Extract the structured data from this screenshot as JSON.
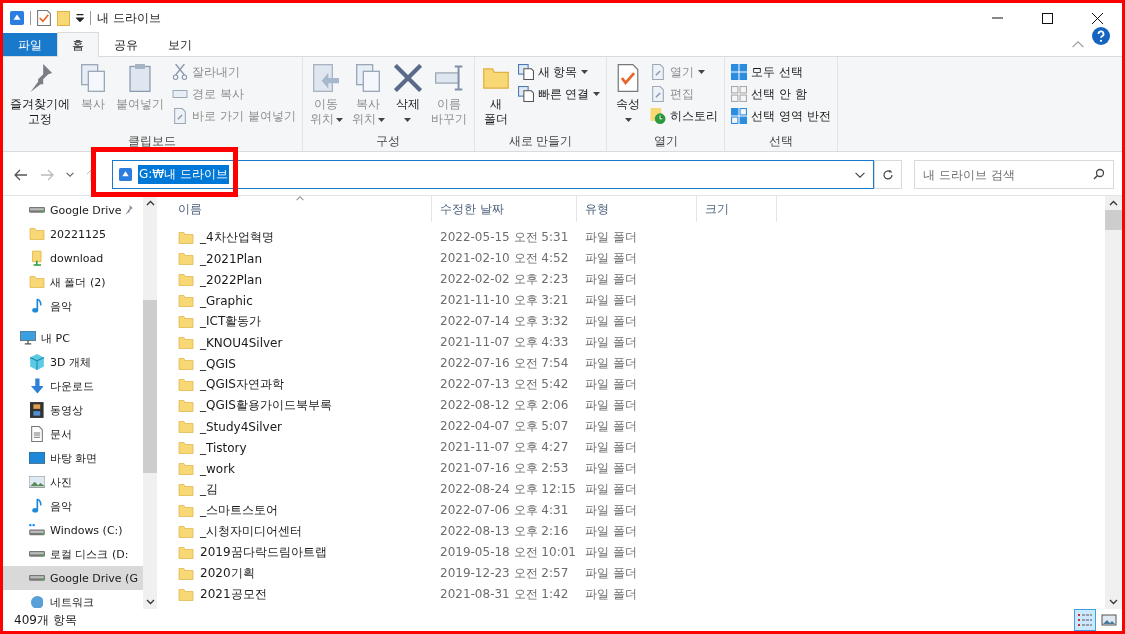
{
  "window": {
    "title": "내 드라이브"
  },
  "ribbon_tabs": [
    {
      "label": "파일",
      "kind": "file",
      "selected": false
    },
    {
      "label": "홈",
      "kind": "tab",
      "selected": true
    },
    {
      "label": "공유",
      "kind": "tab",
      "selected": false
    },
    {
      "label": "보기",
      "kind": "tab",
      "selected": false
    }
  ],
  "ribbon_groups": [
    {
      "label": "클립보드",
      "large": [
        {
          "label": "즐겨찾기에\n고정",
          "kind": "pin",
          "disabled": false
        },
        {
          "label": "복사",
          "kind": "copy",
          "disabled": true
        },
        {
          "label": "붙여넣기",
          "kind": "paste",
          "disabled": true
        }
      ],
      "small": [
        {
          "label": "잘라내기",
          "kind": "cut",
          "disabled": true
        },
        {
          "label": "경로 복사",
          "kind": "path",
          "disabled": true
        },
        {
          "label": "바로 가기 붙여넣기",
          "kind": "shortcut",
          "disabled": true
        }
      ]
    },
    {
      "label": "구성",
      "large": [
        {
          "label": "이동\n위치",
          "kind": "move",
          "disabled": true,
          "dropdown": true
        },
        {
          "label": "복사\n위치",
          "kind": "copyto",
          "disabled": true,
          "dropdown": true
        },
        {
          "label": "삭제",
          "kind": "delete",
          "disabled": false,
          "dropdown": true
        },
        {
          "label": "이름\n바꾸기",
          "kind": "rename",
          "disabled": true
        }
      ]
    },
    {
      "label": "새로 만들기",
      "large": [
        {
          "label": "새\n폴더",
          "kind": "folder",
          "disabled": false
        }
      ],
      "small": [
        {
          "label": "새 항목",
          "kind": "newitem",
          "disabled": false,
          "dropdown": true
        },
        {
          "label": "빠른 연결",
          "kind": "easy",
          "disabled": false,
          "dropdown": true
        }
      ]
    },
    {
      "label": "열기",
      "large": [
        {
          "label": "속성",
          "kind": "props",
          "disabled": false,
          "dropdown": true
        }
      ],
      "small": [
        {
          "label": "열기",
          "kind": "open",
          "disabled": true,
          "dropdown": true
        },
        {
          "label": "편집",
          "kind": "edit",
          "disabled": true
        },
        {
          "label": "히스토리",
          "kind": "history",
          "disabled": false
        }
      ]
    },
    {
      "label": "선택",
      "small": [
        {
          "label": "모두 선택",
          "kind": "selall",
          "disabled": false
        },
        {
          "label": "선택 안 함",
          "kind": "selnone",
          "disabled": false
        },
        {
          "label": "선택 영역 반전",
          "kind": "selinv",
          "disabled": false
        }
      ]
    }
  ],
  "address": {
    "path": "G:₩내 드라이브",
    "selected": true
  },
  "search": {
    "placeholder": "내 드라이브 검색"
  },
  "sidebar": [
    {
      "label": "Google Drive",
      "kind": "drive",
      "pinned": true,
      "selected": false
    },
    {
      "label": "20221125",
      "kind": "folder",
      "selected": false
    },
    {
      "label": "download",
      "kind": "dlfolder",
      "selected": false
    },
    {
      "label": "새 폴더 (2)",
      "kind": "folder",
      "selected": false
    },
    {
      "label": "음악",
      "kind": "music",
      "selected": false
    },
    {
      "label": "내 PC",
      "kind": "pc",
      "selected": false,
      "children": [
        {
          "label": "3D 개체",
          "kind": "cube",
          "selected": false
        },
        {
          "label": "다운로드",
          "kind": "down",
          "selected": false
        },
        {
          "label": "동영상",
          "kind": "video",
          "selected": false
        },
        {
          "label": "문서",
          "kind": "doc",
          "selected": false
        },
        {
          "label": "바탕 화면",
          "kind": "desktop",
          "selected": false
        },
        {
          "label": "사진",
          "kind": "photo",
          "selected": false
        },
        {
          "label": "음악",
          "kind": "music",
          "selected": false
        },
        {
          "label": "Windows (C:)",
          "kind": "windrive",
          "selected": false
        },
        {
          "label": "로컬 디스크 (D:",
          "kind": "drive",
          "selected": false
        },
        {
          "label": "Google Drive (G",
          "kind": "drive",
          "selected": true
        }
      ]
    },
    {
      "label": "네트워크",
      "kind": "network",
      "selected": false
    }
  ],
  "table": {
    "columns": [
      "이름",
      "수정한 날짜",
      "유형",
      "크기"
    ],
    "rows": [
      {
        "name": "_4차산업혁명",
        "modified": "2022-05-15 오전 5:31",
        "type": "파일 폴더"
      },
      {
        "name": "_2021Plan",
        "modified": "2021-02-10 오전 4:52",
        "type": "파일 폴더"
      },
      {
        "name": "_2022Plan",
        "modified": "2022-02-02 오후 2:23",
        "type": "파일 폴더"
      },
      {
        "name": "_Graphic",
        "modified": "2021-11-10 오후 3:21",
        "type": "파일 폴더"
      },
      {
        "name": "_ICT활동가",
        "modified": "2022-07-14 오후 3:32",
        "type": "파일 폴더"
      },
      {
        "name": "_KNOU4Silver",
        "modified": "2021-11-07 오후 4:33",
        "type": "파일 폴더"
      },
      {
        "name": "_QGIS",
        "modified": "2022-07-16 오전 7:54",
        "type": "파일 폴더"
      },
      {
        "name": "_QGIS자연과학",
        "modified": "2022-07-13 오전 5:42",
        "type": "파일 폴더"
      },
      {
        "name": "_QGIS활용가이드북부록",
        "modified": "2022-08-12 오후 2:06",
        "type": "파일 폴더"
      },
      {
        "name": "_Study4Silver",
        "modified": "2022-04-07 오후 5:07",
        "type": "파일 폴더"
      },
      {
        "name": "_Tistory",
        "modified": "2021-11-07 오후 4:27",
        "type": "파일 폴더"
      },
      {
        "name": "_work",
        "modified": "2021-07-16 오후 2:53",
        "type": "파일 폴더"
      },
      {
        "name": "_김",
        "modified": "2022-08-24 오후 12:15",
        "type": "파일 폴더"
      },
      {
        "name": "_스마트스토어",
        "modified": "2022-07-06 오후 4:31",
        "type": "파일 폴더"
      },
      {
        "name": "_시청자미디어센터",
        "modified": "2022-08-13 오후 2:16",
        "type": "파일 폴더"
      },
      {
        "name": "2019꿈다락드림아트랩",
        "modified": "2019-05-18 오전 10:01",
        "type": "파일 폴더"
      },
      {
        "name": "2020기획",
        "modified": "2019-12-23 오전 2:57",
        "type": "파일 폴더"
      },
      {
        "name": "2021공모전",
        "modified": "2021-08-31 오전 1:42",
        "type": "파일 폴더"
      }
    ]
  },
  "status_bar": {
    "count": "409개 항목",
    "views": [
      {
        "kind": "details",
        "selected": true
      },
      {
        "kind": "large",
        "selected": false
      }
    ]
  }
}
